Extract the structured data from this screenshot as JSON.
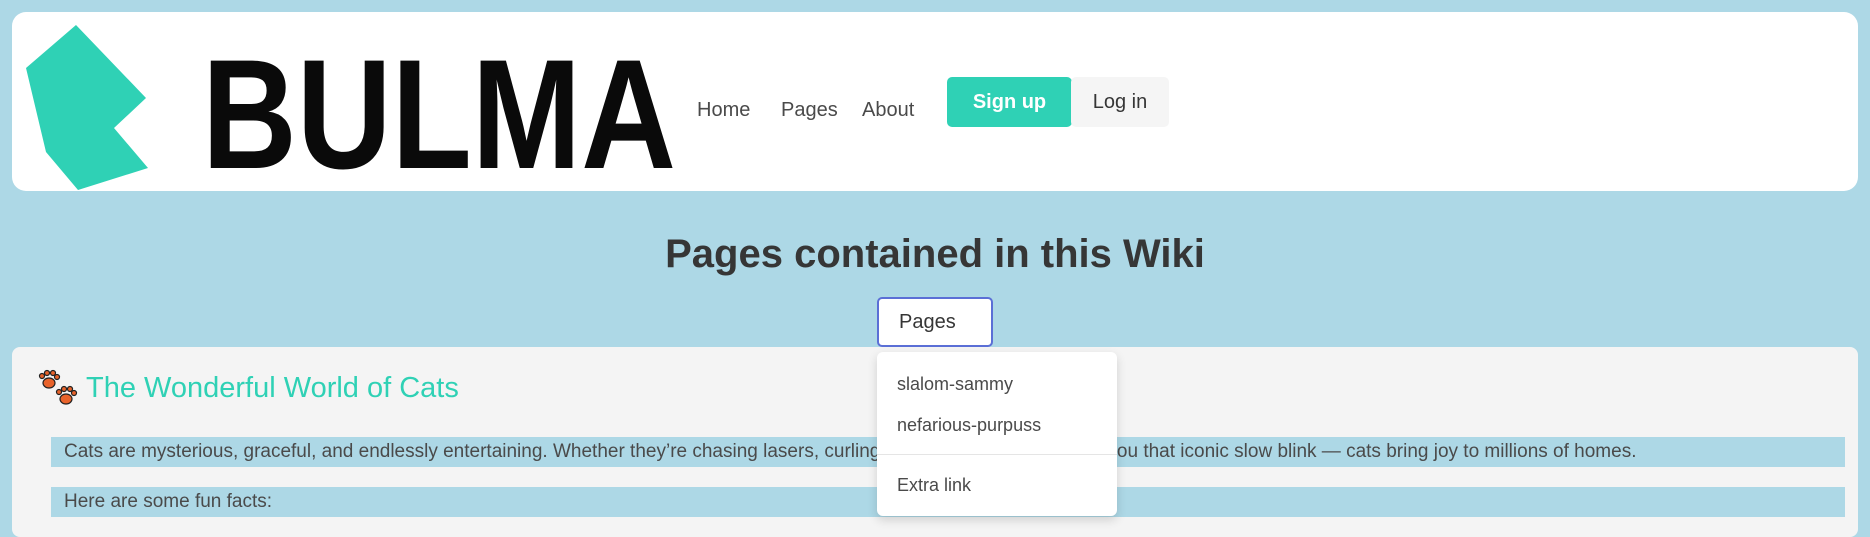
{
  "brand": {
    "logo_text": "BULMA",
    "accent_color": "#2fd1b5"
  },
  "navbar": {
    "links": [
      "Home",
      "Pages",
      "About"
    ],
    "signup_label": "Sign up",
    "login_label": "Log in"
  },
  "page": {
    "title": "Pages contained in this Wiki"
  },
  "dropdown": {
    "trigger_label": "Pages",
    "items": [
      "slalom-sammy",
      "nefarious-purpuss"
    ],
    "extra_item": "Extra link"
  },
  "article": {
    "icon": "paw-prints-icon",
    "title": "The Wonderful World of Cats",
    "intro": "Cats are mysterious, graceful, and endlessly entertaining. Whether they’re chasing lasers, curling up in sunbeams, or giving you that iconic slow blink — cats bring joy to millions of homes.",
    "facts_lead": "Here are some fun facts:"
  }
}
